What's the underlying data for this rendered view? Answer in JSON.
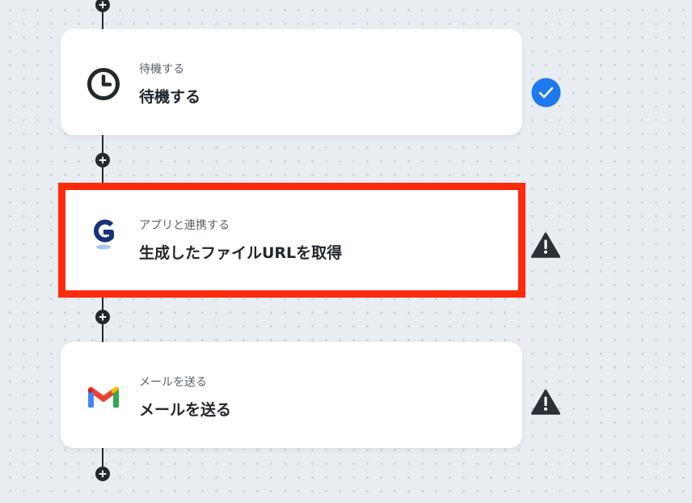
{
  "steps": [
    {
      "subtitle": "待機する",
      "title": "待機する",
      "icon": "clock-icon",
      "status": "completed"
    },
    {
      "subtitle": "アプリと連携する",
      "title": "生成したファイルURLを取得",
      "icon": "g-app-logo-icon",
      "status": "warning",
      "selected": true
    },
    {
      "subtitle": "メールを送る",
      "title": "メールを送る",
      "icon": "gmail-icon",
      "status": "warning"
    }
  ],
  "colors": {
    "canvas": "#e9ecf1",
    "connector": "#23272e",
    "check_badge": "#1e78f0",
    "warning": "#2b2f36",
    "selection_outline": "#ff2a0a",
    "g_logo": "#17327a"
  }
}
